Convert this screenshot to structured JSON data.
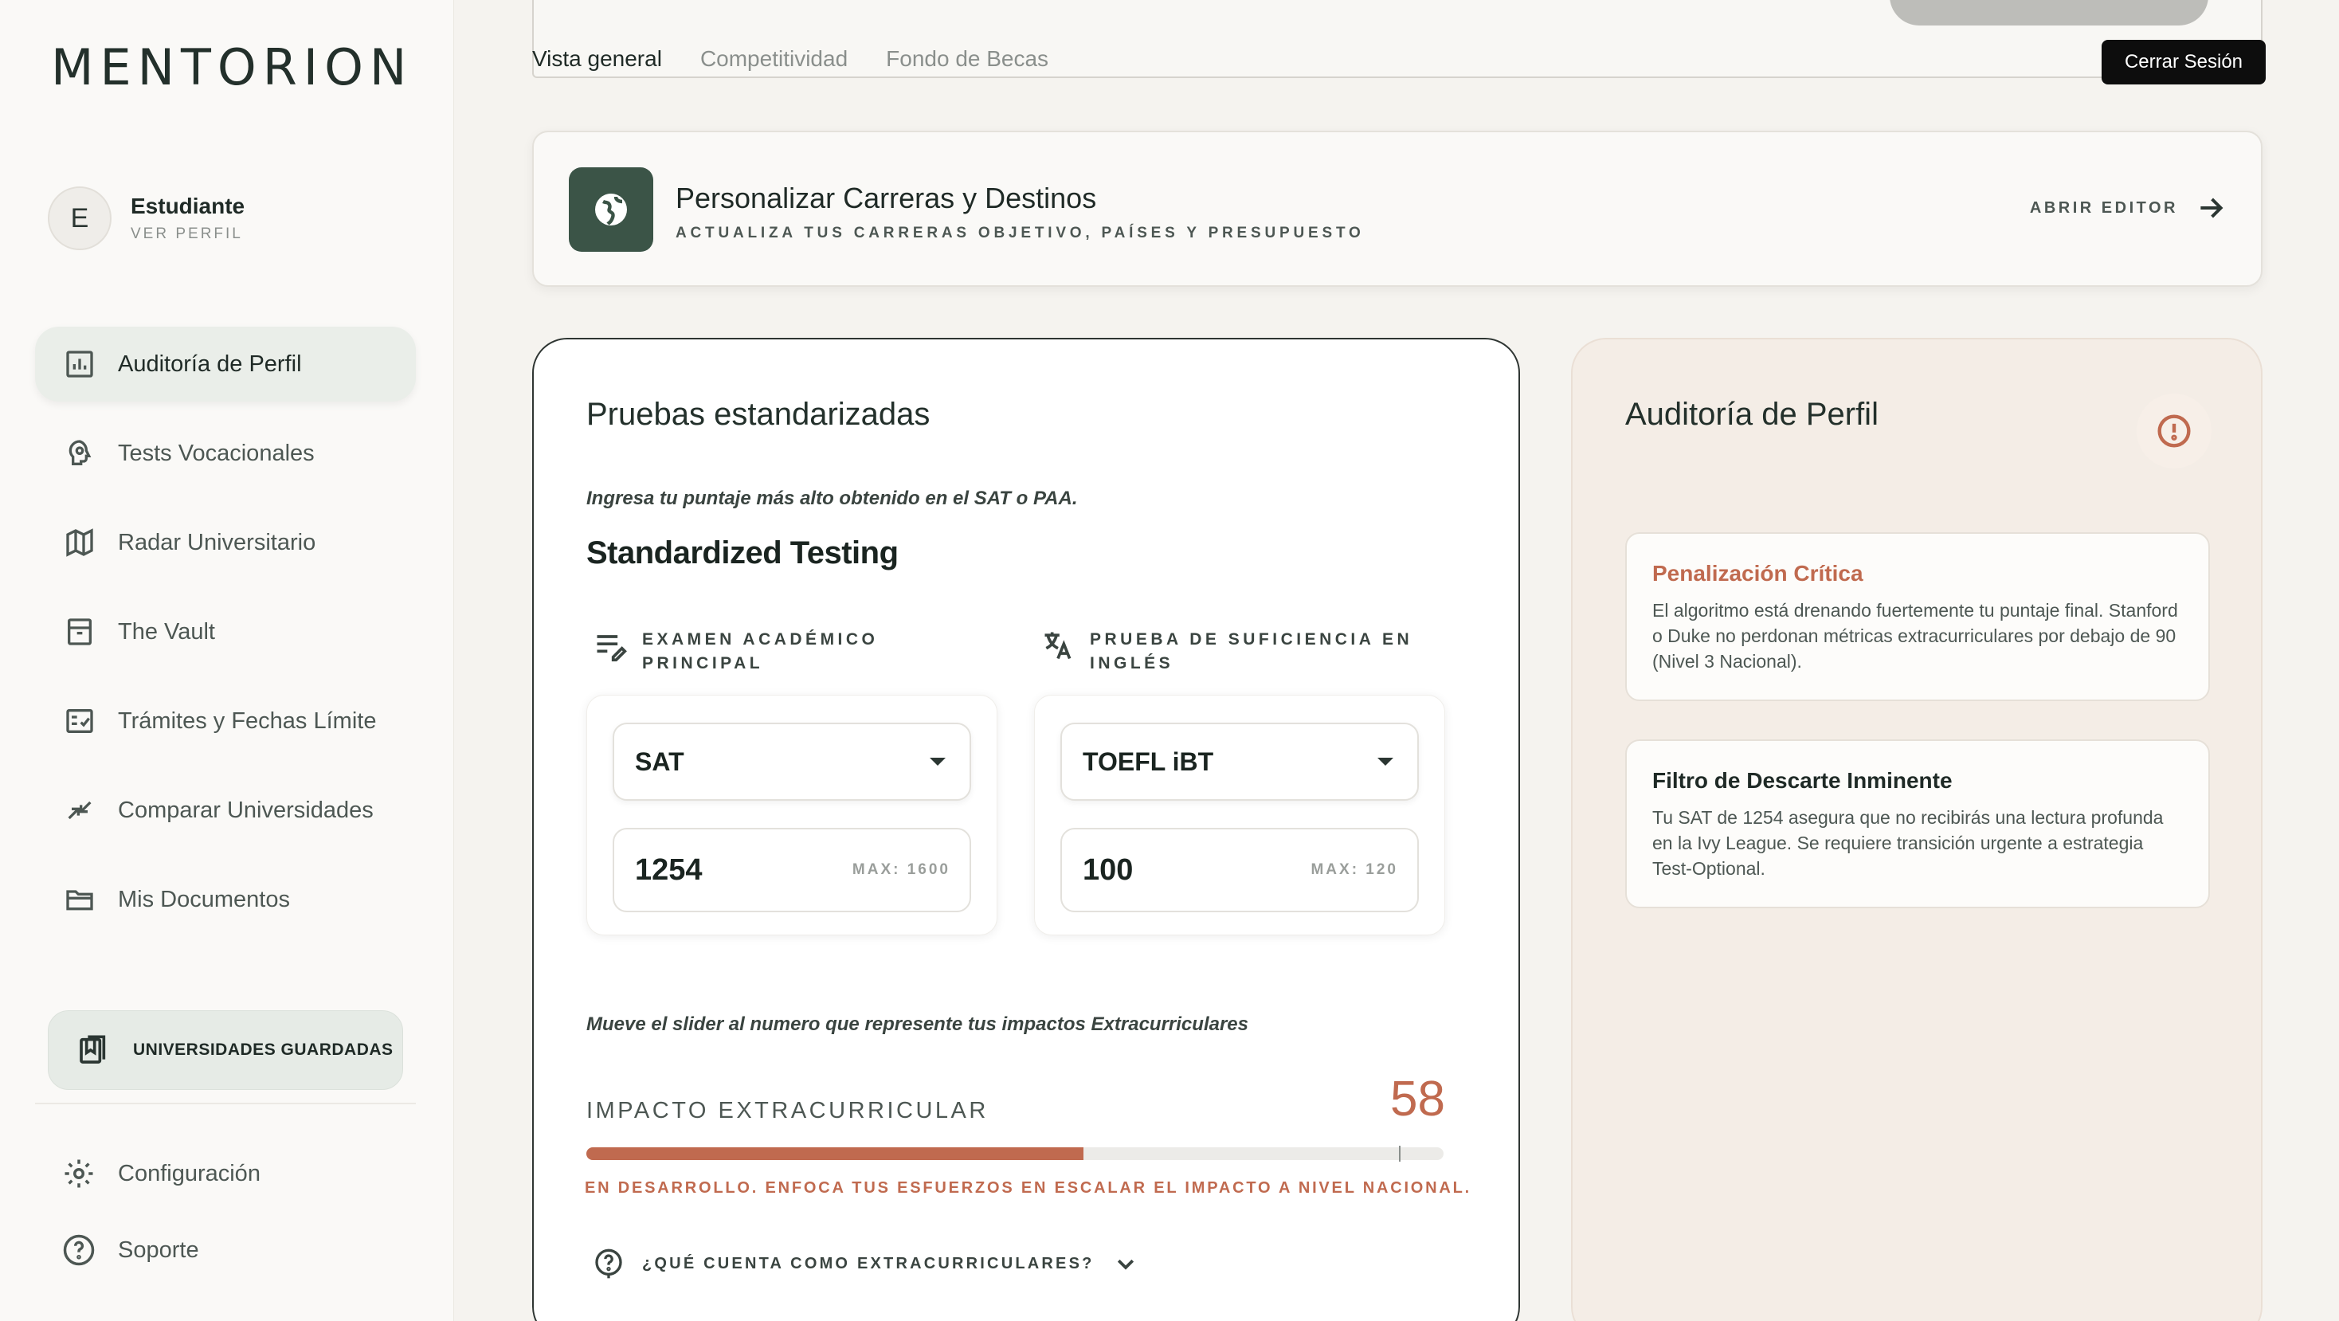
{
  "app": {
    "logo": "MENTORION"
  },
  "profile": {
    "initial": "E",
    "name": "Estudiante",
    "link": "VER PERFIL"
  },
  "sidebar": {
    "items": [
      {
        "label": "Auditoría de Perfil",
        "icon": "chart-icon",
        "active": true
      },
      {
        "label": "Tests Vocacionales",
        "icon": "brain-icon",
        "active": false
      },
      {
        "label": "Radar Universitario",
        "icon": "map-icon",
        "active": false
      },
      {
        "label": "The Vault",
        "icon": "archive-icon",
        "active": false
      },
      {
        "label": "Trámites y Fechas Límite",
        "icon": "checklist-icon",
        "active": false
      },
      {
        "label": "Comparar Universidades",
        "icon": "compare-arrows-icon",
        "active": false
      },
      {
        "label": "Mis Documentos",
        "icon": "folder-icon",
        "active": false
      }
    ],
    "saved_button": "UNIVERSIDADES GUARDADAS",
    "settings": "Configuración",
    "support": "Soporte"
  },
  "topbar": {
    "tabs": [
      {
        "label": "Vista general",
        "active": true
      },
      {
        "label": "Competitividad",
        "active": false
      },
      {
        "label": "Fondo de Becas",
        "active": false
      }
    ],
    "logout": "Cerrar Sesión"
  },
  "personalize": {
    "title": "Personalizar Carreras y Destinos",
    "subtitle": "ACTUALIZA TUS CARRERAS OBJETIVO, PAÍSES Y PRESUPUESTO",
    "action": "ABRIR EDITOR"
  },
  "tests": {
    "title": "Pruebas estandarizadas",
    "hint": "Ingresa tu puntaje más alto obtenido en el SAT o PAA.",
    "heading": "Standardized Testing",
    "academic": {
      "label_line1": "EXAMEN ACADÉMICO",
      "label_line2": "PRINCIPAL",
      "exam": "SAT",
      "score": "1254",
      "max": "MAX: 1600"
    },
    "english": {
      "label_line1": "PRUEBA DE SUFICIENCIA EN",
      "label_line2": "INGLÉS",
      "exam": "TOEFL iBT",
      "score": "100",
      "max": "MAX: 120"
    },
    "slider_hint": "Mueve el slider al numero que represente tus impactos Extracurriculares",
    "slider_label": "IMPACTO EXTRACURRICULAR",
    "slider_value": "58",
    "slider_fill_fraction": 0.58,
    "slider_message": "EN DESARROLLO. ENFOCA TUS ESFUERZOS EN ESCALAR EL IMPACTO A NIVEL NACIONAL.",
    "faq": "¿QUÉ CUENTA COMO EXTRACURRICULARES?"
  },
  "audit": {
    "title": "Auditoría de Perfil",
    "cards": [
      {
        "title": "Penalización Crítica",
        "body": "El algoritmo está drenando fuertemente tu puntaje final. Stanford o Duke no perdonan métricas extracurriculares por debajo de 90 (Nivel 3 Nacional).",
        "color": "#c06a4f"
      },
      {
        "title": "Filtro de Descarte Inminente",
        "body": "Tu SAT de 1254 asegura que no recibirás una lectura profunda en la Ivy League. Se requiere transición urgente a estrategia Test-Optional.",
        "color": "#1f2a26"
      }
    ]
  },
  "colors": {
    "accent": "#c06a4f",
    "brand_dark": "#3b5447",
    "active_nav": "#eaeee9"
  }
}
